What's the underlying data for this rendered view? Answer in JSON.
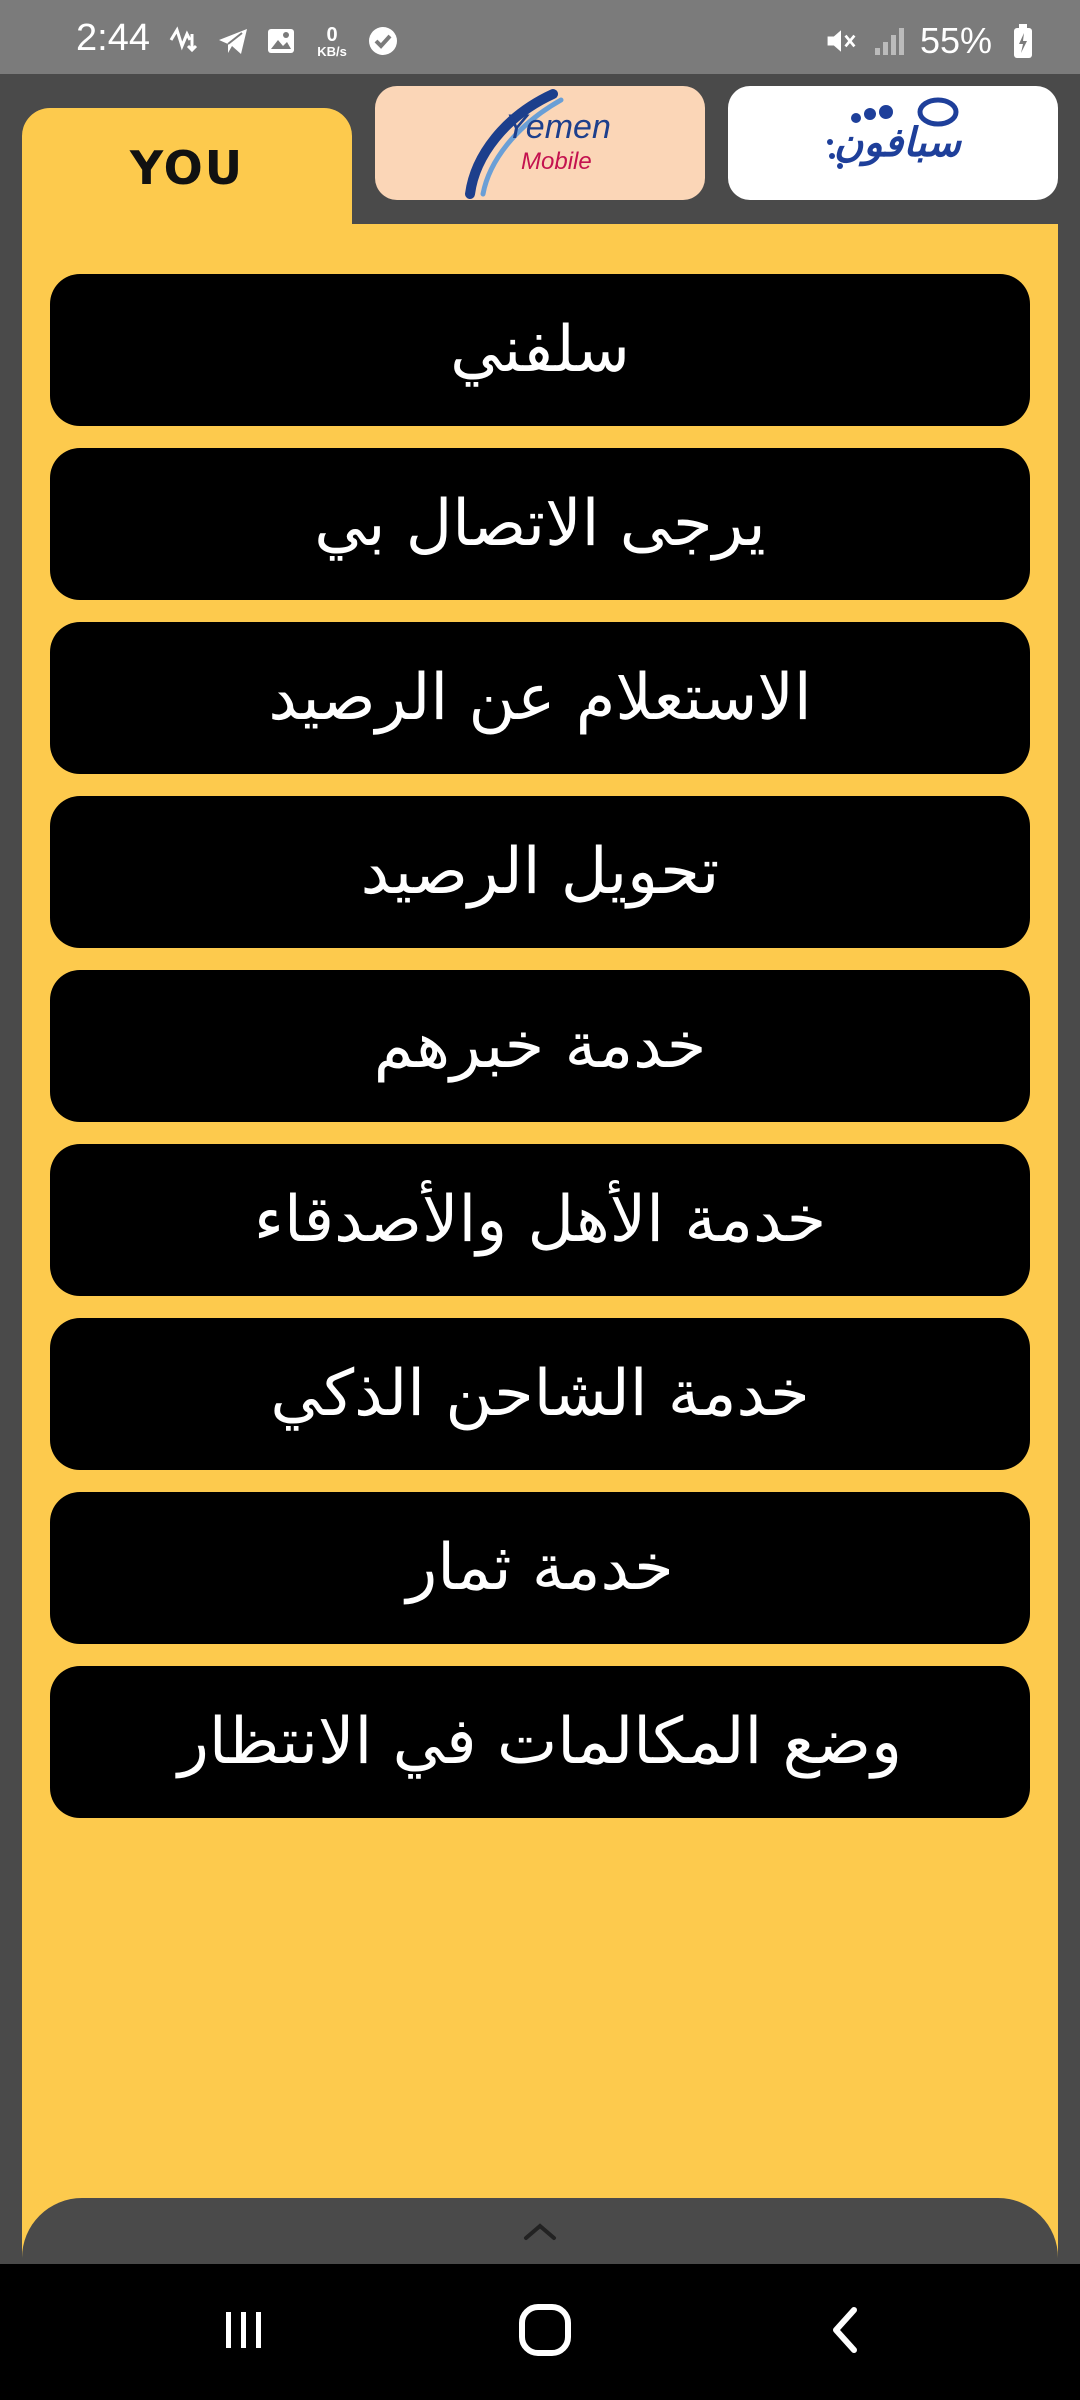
{
  "status_bar": {
    "time": "2:44",
    "net_speed_value": "0",
    "net_speed_unit": "KB/s",
    "battery_percent": "55%"
  },
  "tabs": {
    "you_label": "YOU",
    "yemen_mobile_name": "Yemen",
    "yemen_mobile_sub": "Mobile",
    "sabafon_name": "سبافون"
  },
  "menu": {
    "items": [
      {
        "label": "سلفني"
      },
      {
        "label": "يرجى الاتصال بي"
      },
      {
        "label": "الاستعلام عن الرصيد"
      },
      {
        "label": "تحويل الرصيد"
      },
      {
        "label": "خدمة خبرهم"
      },
      {
        "label": "خدمة الأهل والأصدقاء"
      },
      {
        "label": "خدمة الشاحن الذكي"
      },
      {
        "label": "خدمة ثمار"
      },
      {
        "label": "وضع المكالمات في الانتظار"
      }
    ]
  },
  "colors": {
    "panel": "#fdca4d",
    "menu_button": "#000000",
    "background": "#4a4a4a",
    "status_bar": "#7b7b7b",
    "yemen_tab": "#fbd6b7",
    "sabafon_tab": "#ffffff"
  },
  "icons": {
    "status_left": [
      "network-activity-icon",
      "telegram-icon",
      "gallery-icon",
      "verified-icon"
    ],
    "status_right": [
      "mute-icon",
      "signal-icon",
      "battery-charging-icon"
    ],
    "sheet": "chevron-up-icon",
    "nav": [
      "recent-apps-icon",
      "home-icon",
      "back-icon"
    ]
  }
}
